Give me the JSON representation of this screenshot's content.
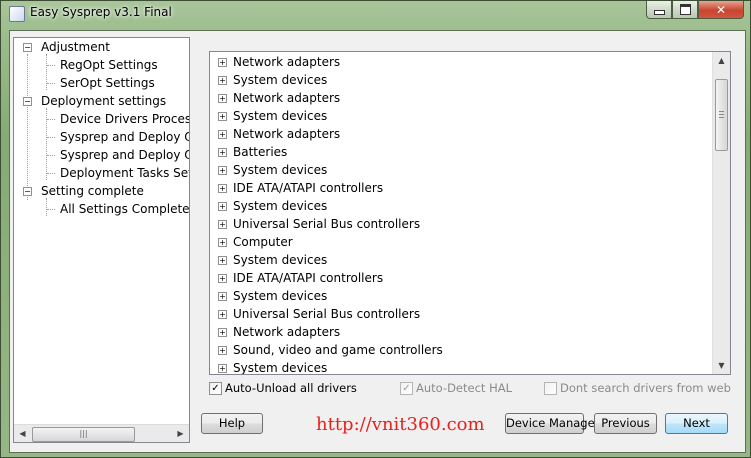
{
  "window": {
    "title": "Easy Sysprep v3.1 Final",
    "close_glyph": "✕"
  },
  "left_tree": {
    "groups": [
      {
        "label": "Adjustment",
        "expander": "−",
        "children": [
          "RegOpt Settings",
          "SerOpt Settings"
        ]
      },
      {
        "label": "Deployment settings",
        "expander": "−",
        "children": [
          "Device Drivers Processing",
          "Sysprep and Deploy Options",
          "Sysprep and Deploy Options",
          "Deployment Tasks Settings"
        ]
      },
      {
        "label": "Setting complete",
        "expander": "−",
        "children": [
          "All Settings Complete"
        ]
      }
    ]
  },
  "devices": [
    "Network adapters",
    "System devices",
    "Network adapters",
    "System devices",
    "Network adapters",
    "Batteries",
    "System devices",
    "IDE ATA/ATAPI controllers",
    "System devices",
    "Universal Serial Bus controllers",
    "Computer",
    "System devices",
    "IDE ATA/ATAPI controllers",
    "System devices",
    "Universal Serial Bus controllers",
    "Network adapters",
    "Sound, video and game controllers",
    "System devices"
  ],
  "device_expander": "+",
  "options": {
    "auto_unload": {
      "label": "Auto-Unload all drivers",
      "checked": true,
      "mark": "✓"
    },
    "auto_detect": {
      "label": "Auto-Detect HAL",
      "checked": true,
      "mark": "✓"
    },
    "dont_search": {
      "label": "Dont search drivers from web",
      "checked": false,
      "mark": ""
    }
  },
  "buttons": {
    "help": "Help",
    "device_manager": "Device Manager",
    "previous": "Previous",
    "next": "Next"
  },
  "watermark": "http://vnit360.com",
  "scroll": {
    "up": "▲",
    "down": "▼",
    "left": "◀",
    "right": "▶",
    "grip": "|||"
  }
}
